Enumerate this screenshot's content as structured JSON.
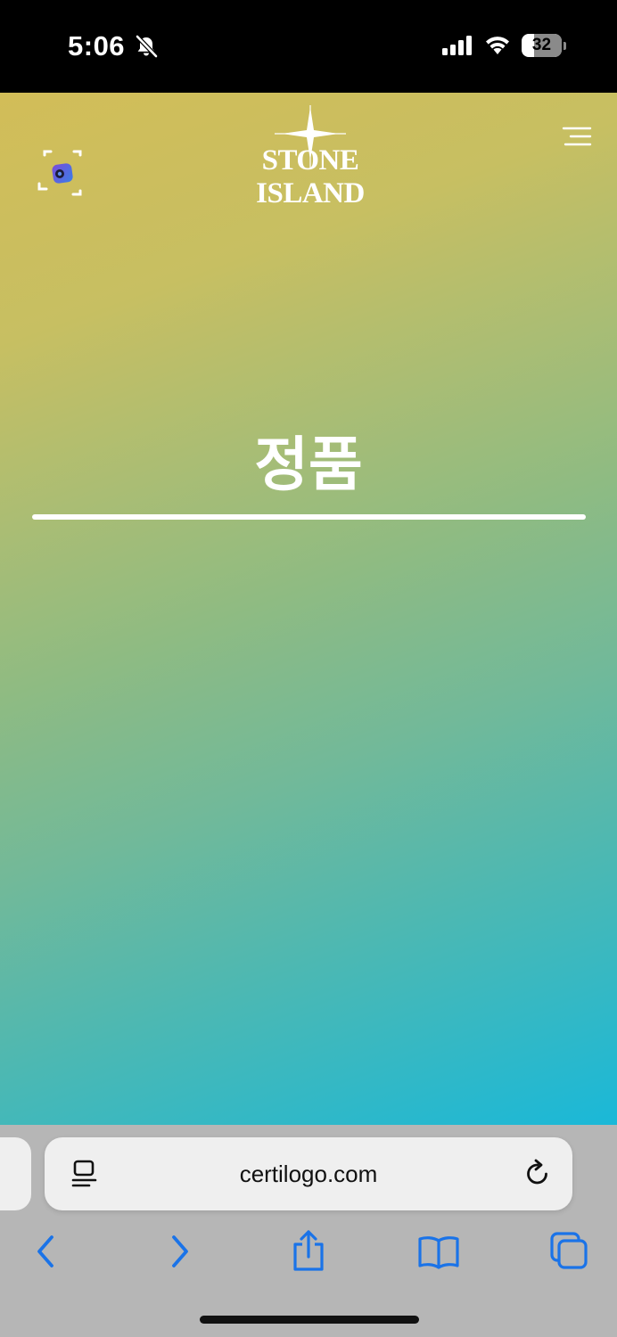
{
  "status_bar": {
    "time": "5:06",
    "battery_level": "32",
    "battery_fraction": 0.32
  },
  "page": {
    "logo_text": "STONE ISLAND",
    "headline": "정품"
  },
  "safari": {
    "url": "certilogo.com",
    "accent_color": "#1a73e8"
  },
  "icons": {
    "scan": "scan-camera-icon",
    "menu": "hamburger-menu-icon",
    "reader": "reader-mode-icon",
    "reload": "reload-icon",
    "back": "chevron-left-icon",
    "forward": "chevron-right-icon",
    "share": "share-icon",
    "bookmarks": "book-icon",
    "tabs": "tabs-icon"
  }
}
